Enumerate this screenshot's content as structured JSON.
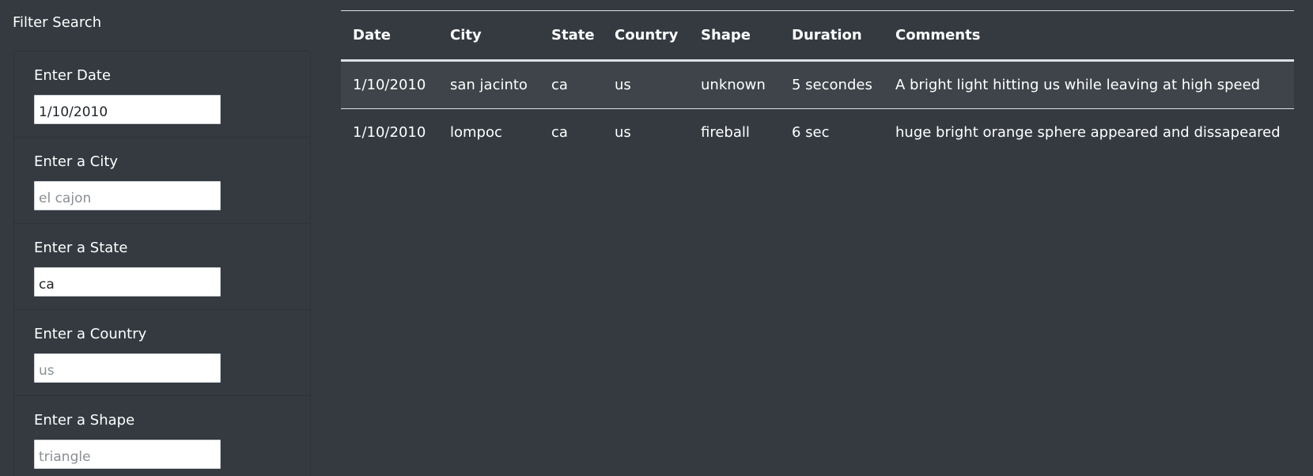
{
  "sidebar": {
    "title": "Filter Search",
    "filters": [
      {
        "label": "Enter Date",
        "value": "1/10/2010",
        "placeholder": ""
      },
      {
        "label": "Enter a City",
        "value": "",
        "placeholder": "el cajon"
      },
      {
        "label": "Enter a State",
        "value": "ca",
        "placeholder": ""
      },
      {
        "label": "Enter a Country",
        "value": "",
        "placeholder": "us"
      },
      {
        "label": "Enter a Shape",
        "value": "",
        "placeholder": "triangle"
      }
    ]
  },
  "table": {
    "headers": [
      "Date",
      "City",
      "State",
      "Country",
      "Shape",
      "Duration",
      "Comments"
    ],
    "rows": [
      [
        "1/10/2010",
        "san jacinto",
        "ca",
        "us",
        "unknown",
        "5 secondes",
        "A bright light hitting us while leaving at high speed"
      ],
      [
        "1/10/2010",
        "lompoc",
        "ca",
        "us",
        "fireball",
        "6 sec",
        "huge bright orange sphere appeared and dissapeared"
      ]
    ]
  }
}
